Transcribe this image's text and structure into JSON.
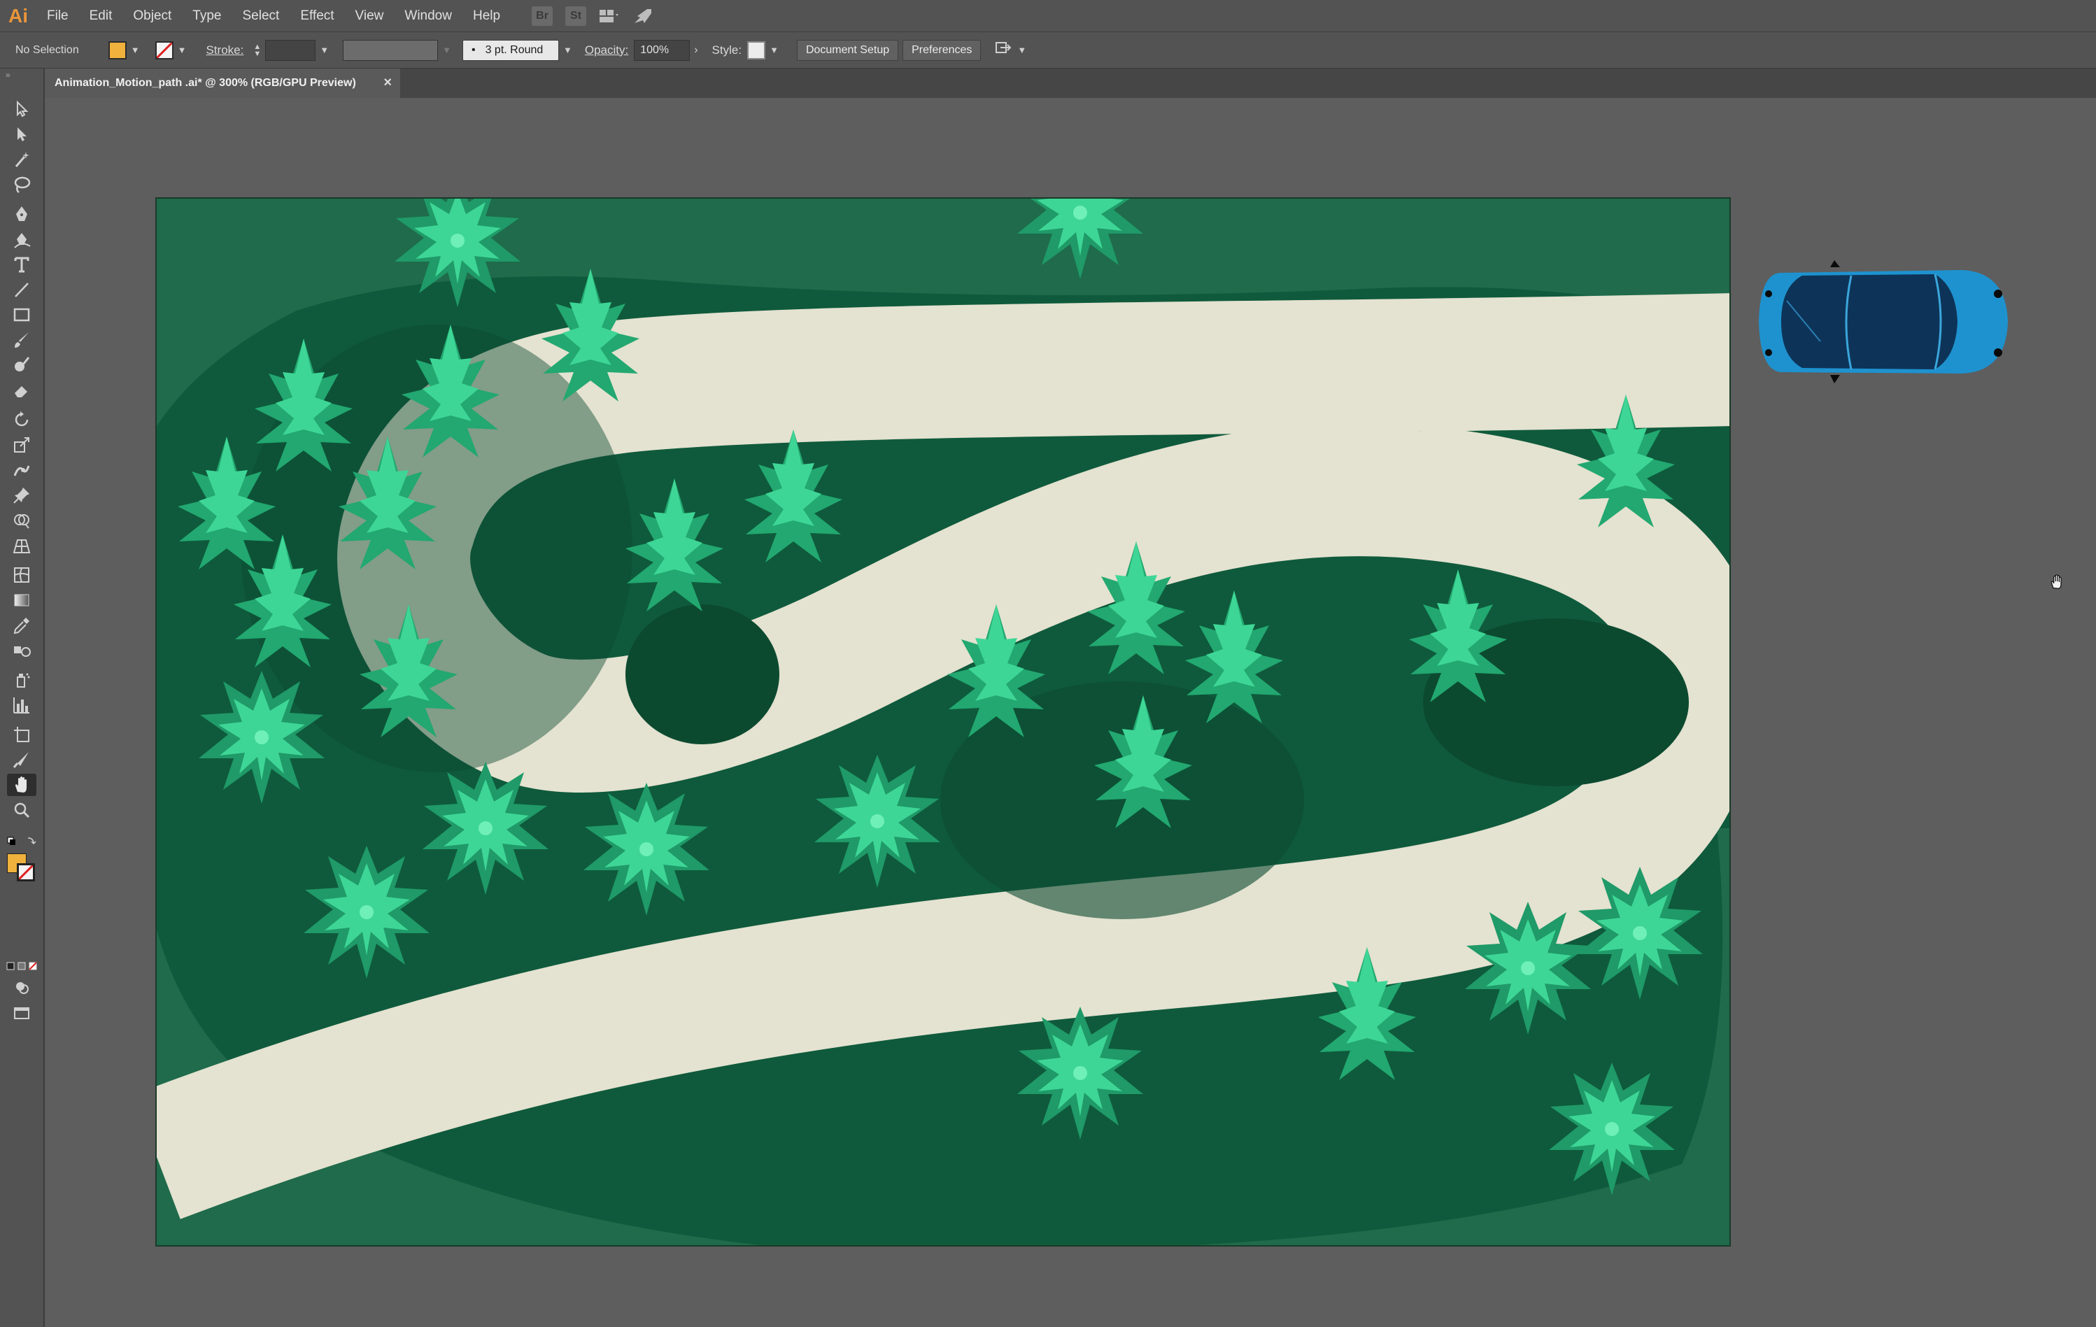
{
  "app": {
    "logo": "Ai"
  },
  "menu": [
    "File",
    "Edit",
    "Object",
    "Type",
    "Select",
    "Effect",
    "View",
    "Window",
    "Help"
  ],
  "menu_icons": [
    "Br",
    "St",
    "workspace-grid-icon",
    "rocket-icon"
  ],
  "control_bar": {
    "selection": "No Selection",
    "fill_color": "#f0b23c",
    "stroke_label": "Stroke:",
    "brush_label": "3 pt. Round",
    "opacity_label": "Opacity:",
    "opacity_value": "100%",
    "style_label": "Style:",
    "document_setup": "Document Setup",
    "preferences": "Preferences"
  },
  "document_tab": {
    "title": "Animation_Motion_path .ai* @ 300% (RGB/GPU Preview)",
    "close": "×"
  },
  "colors": {
    "canvas_bg": "#5e5e5e",
    "grass_light": "#1f6b4b",
    "grass_dark": "#0f5a3c",
    "road": "#e4e2d0",
    "tree_light": "#3ed696",
    "tree_mid": "#22a870",
    "tree_dark": "#0c4a30",
    "car_body": "#1e92cf",
    "car_roof": "#0d3458"
  },
  "artwork": {
    "subject": "top-down forest with winding road",
    "car": "blue car viewed from above"
  }
}
